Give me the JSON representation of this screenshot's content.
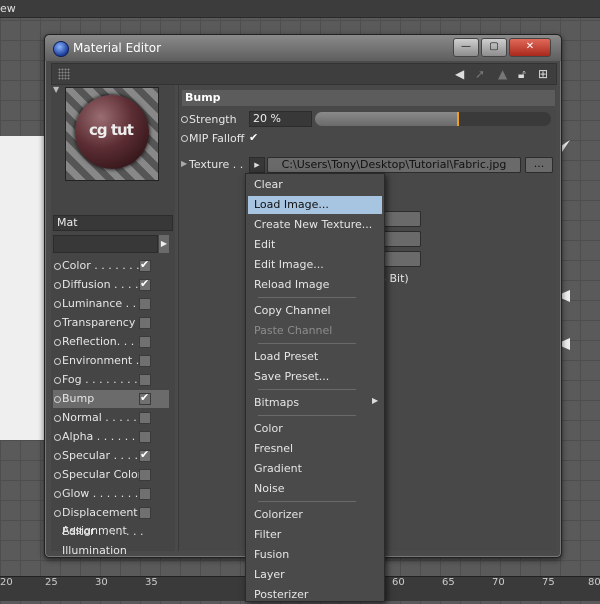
{
  "topbar": {
    "text": "ew"
  },
  "ruler": {
    "ticks": [
      "20",
      "25",
      "30",
      "35",
      "60",
      "65",
      "70",
      "75",
      "80"
    ]
  },
  "window": {
    "title": "Material Editor",
    "buttons": {
      "minimize": "—",
      "maximize": "▢",
      "close": "✕"
    }
  },
  "material": {
    "name": "Mat",
    "preview_text": "cg tut"
  },
  "channels": [
    {
      "label": "Color . . . . . . .",
      "checked": true
    },
    {
      "label": "Diffusion . . . .",
      "checked": true
    },
    {
      "label": "Luminance . . .",
      "checked": false
    },
    {
      "label": "Transparency",
      "checked": false
    },
    {
      "label": "Reflection. . . .",
      "checked": false
    },
    {
      "label": "Environment . .",
      "checked": false
    },
    {
      "label": "Fog . . . . . . . . .",
      "checked": false
    },
    {
      "label": "Bump",
      "checked": true,
      "active": true
    },
    {
      "label": "Normal . . . . . .",
      "checked": false
    },
    {
      "label": "Alpha . . . . . . .",
      "checked": false
    },
    {
      "label": "Specular . . . .",
      "checked": true
    },
    {
      "label": "Specular Color",
      "checked": false
    },
    {
      "label": "Glow . . . . . . .",
      "checked": false
    },
    {
      "label": "Displacement",
      "checked": false
    }
  ],
  "extras": [
    "Editor . . . . . . .",
    "Illumination",
    "Assignment"
  ],
  "bump": {
    "header": "Bump",
    "strength_label": "Strength",
    "strength_value": "20 %",
    "strength_fraction": 0.2,
    "mip_label": "MIP Falloff",
    "texture_label": "Texture . .",
    "texture_path": "C:\\Users\\Tony\\Desktop\\Tutorial\\Fabric.jpg",
    "more": "...",
    "bit_text": "8 Bit)"
  },
  "menu": [
    {
      "label": "Clear"
    },
    {
      "label": "Load Image...",
      "highlight": true
    },
    {
      "label": "Create New Texture..."
    },
    {
      "label": "Edit"
    },
    {
      "label": "Edit Image..."
    },
    {
      "label": "Reload Image"
    },
    {
      "label": "Copy Channel"
    },
    {
      "label": "Paste Channel",
      "disabled": true
    },
    {
      "label": "Load Preset"
    },
    {
      "label": "Save Preset..."
    },
    {
      "label": "Bitmaps",
      "submenu": true
    },
    {
      "label": "Color"
    },
    {
      "label": "Fresnel"
    },
    {
      "label": "Gradient"
    },
    {
      "label": "Noise"
    },
    {
      "label": "Colorizer"
    },
    {
      "label": "Filter"
    },
    {
      "label": "Fusion"
    },
    {
      "label": "Layer"
    },
    {
      "label": "Posterizer"
    }
  ]
}
